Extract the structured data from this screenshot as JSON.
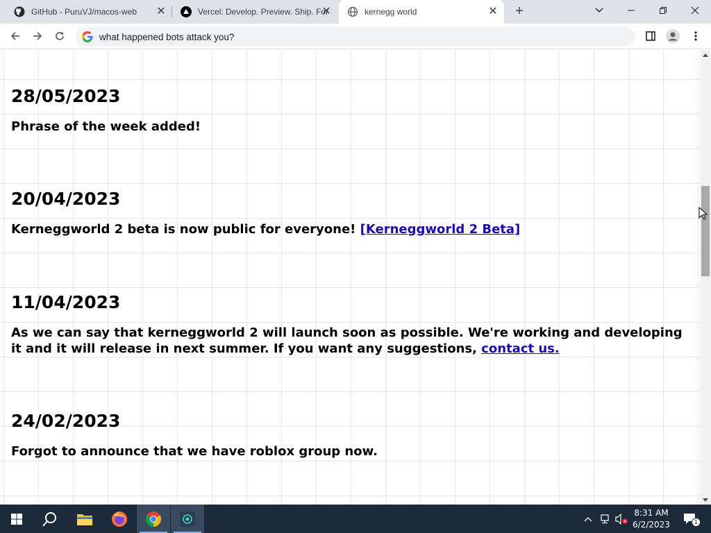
{
  "browser": {
    "tabs": [
      {
        "title": "GitHub - PuruVJ/macos-web",
        "icon": "github-icon"
      },
      {
        "title": "Vercel: Develop. Preview. Ship. For",
        "icon": "vercel-icon"
      },
      {
        "title": "kernegg world",
        "icon": "globe-icon"
      }
    ],
    "active_tab": 2,
    "address_bar": "what happened bots attack you?"
  },
  "page": {
    "entries": [
      {
        "date": "28/05/2023",
        "text": "Phrase of the week added!"
      },
      {
        "date": "20/04/2023",
        "text": "Kerneggworld 2 beta is now public for everyone! ",
        "link": "[Kerneggworld 2 Beta]"
      },
      {
        "date": "11/04/2023",
        "text": "As we can say that kerneggworld 2 will launch soon as possible. We're working and developing it and it will release in next summer. If you want any suggestions, ",
        "link": "contact us."
      },
      {
        "date": "24/02/2023",
        "text": "Forgot to announce that we have roblox group now."
      }
    ]
  },
  "taskbar": {
    "time": "8:31 AM",
    "date": "6/2/2023",
    "notification_count": "1"
  },
  "colors": {
    "link": "#1a0dab",
    "taskbar": "#1c2a3a",
    "tabstrip": "#dee1e6"
  }
}
